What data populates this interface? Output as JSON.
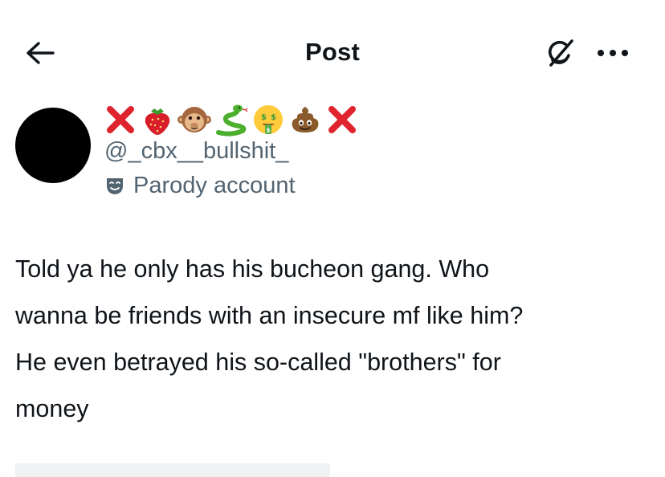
{
  "header": {
    "title": "Post",
    "back_icon": "arrow-left-icon",
    "grok_icon": "grok-icon",
    "more_icon": "more-horizontal-icon"
  },
  "author": {
    "display_name_glyphs": [
      "red-x-icon",
      "strawberry-icon",
      "monkey-face-icon",
      "snake-icon",
      "money-mouth-face-icon",
      "poop-icon",
      "red-x-icon"
    ],
    "handle": "@_cbx__bullshit_",
    "badge_icon": "theater-mask-icon",
    "badge_label": "Parody account"
  },
  "post": {
    "text": "Told ya he only has his bucheon gang. Who\nwanna be friends with an insecure mf like him?\nHe even betrayed his so-called \"brothers\" for\nmoney"
  },
  "colors": {
    "text_primary": "#0f1419",
    "text_secondary": "#536471",
    "avatar": "#000000",
    "media_placeholder": "#eff3f4",
    "emoji_red": "#e0242e"
  }
}
